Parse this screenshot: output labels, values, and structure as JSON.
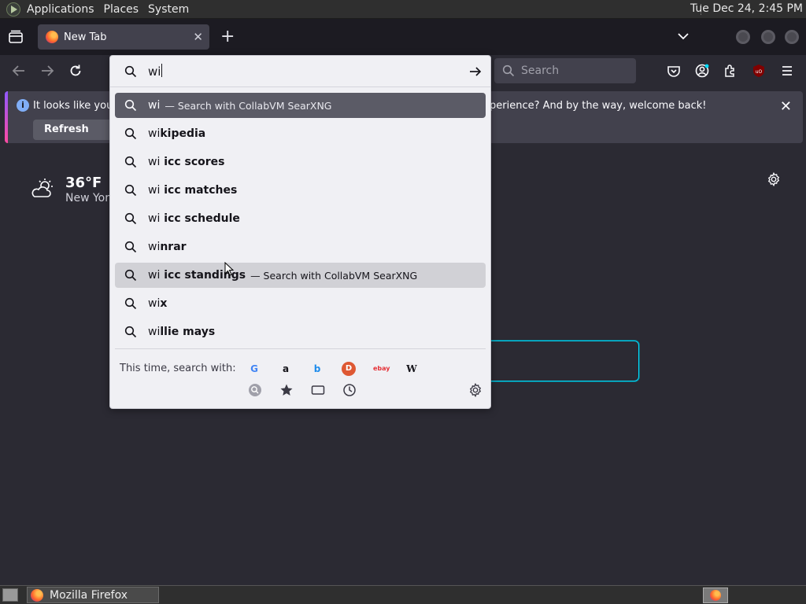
{
  "top_panel": {
    "menus": [
      "Applications",
      "Places",
      "System"
    ],
    "clock": "Tue Dec 24,  2:45 PM"
  },
  "tab": {
    "title": "New Tab",
    "close": "✕"
  },
  "new_tab": "+",
  "search_bar": {
    "placeholder": "Search"
  },
  "notification": {
    "message_left": "It looks like you h",
    "message_right": "perience? And by the way, welcome back!",
    "button": "Refresh Firefox",
    "close": "✕"
  },
  "weather": {
    "temperature": "36°F",
    "city": "New York"
  },
  "urlbar": {
    "typed": "wi",
    "results": [
      {
        "typed": "wi",
        "rest": "",
        "suffix": "— Search with CollabVM SearXNG",
        "state": "selected"
      },
      {
        "typed": "wi",
        "rest": "kipedia",
        "suffix": "",
        "state": ""
      },
      {
        "typed": "wi",
        "rest": " icc scores",
        "suffix": "",
        "state": ""
      },
      {
        "typed": "wi",
        "rest": " icc matches",
        "suffix": "",
        "state": ""
      },
      {
        "typed": "wi",
        "rest": " icc schedule",
        "suffix": "",
        "state": ""
      },
      {
        "typed": "wi",
        "rest": "nrar",
        "suffix": "",
        "state": ""
      },
      {
        "typed": "wi",
        "rest": " icc standings",
        "suffix": "— Search with CollabVM SearXNG",
        "state": "hovered"
      },
      {
        "typed": "wi",
        "rest": "x",
        "suffix": "",
        "state": ""
      },
      {
        "typed": "wi",
        "rest": "llie mays",
        "suffix": "",
        "state": ""
      }
    ],
    "one_off_label": "This time, search with:",
    "engines": [
      {
        "name": "google-icon",
        "glyph": "G",
        "color": "#4285f4"
      },
      {
        "name": "amazon-icon",
        "glyph": "a",
        "color": "#15141a"
      },
      {
        "name": "bing-icon",
        "glyph": "b",
        "color": "#1f8ceb"
      },
      {
        "name": "duckduckgo-icon",
        "glyph": "D",
        "color": "#de5833"
      },
      {
        "name": "ebay-icon",
        "glyph": "ebay",
        "color": "#e53238"
      },
      {
        "name": "wikipedia-icon",
        "glyph": "W",
        "color": "#15141a"
      }
    ]
  },
  "taskbar": {
    "window_title": "Mozilla Firefox"
  }
}
